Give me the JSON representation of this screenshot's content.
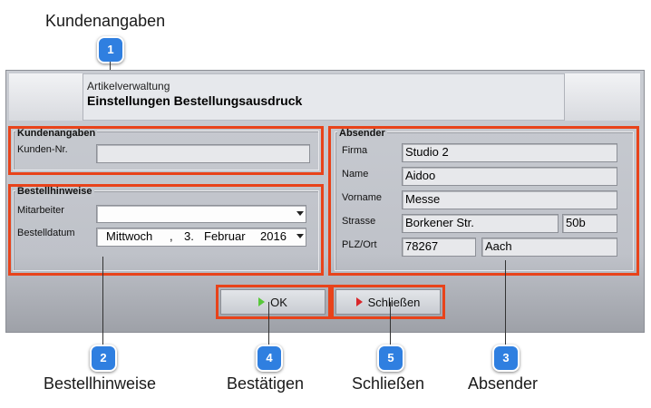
{
  "callouts": {
    "kundenangaben": {
      "text": "Kundenangaben",
      "num": "1"
    },
    "bestellhinweise": {
      "text": "Bestellhinweise",
      "num": "2"
    },
    "absender": {
      "text": "Absender",
      "num": "3"
    },
    "bestaetigen": {
      "text": "Bestätigen",
      "num": "4"
    },
    "schliessen": {
      "text": "Schließen",
      "num": "5"
    }
  },
  "header": {
    "subtitle": "Artikelverwaltung",
    "title": "Einstellungen Bestellungsausdruck"
  },
  "kunden": {
    "group_title": "Kundenangaben",
    "kunden_nr_label": "Kunden-Nr.",
    "kunden_nr_value": ""
  },
  "bestell": {
    "group_title": "Bestellhinweise",
    "mitarbeiter_label": "Mitarbeiter",
    "mitarbeiter_value": "",
    "bestelldatum_label": "Bestelldatum",
    "date_weekday": "Mittwoch",
    "date_sep": ",",
    "date_day": "3.",
    "date_month": "Februar",
    "date_year": "2016"
  },
  "absender": {
    "group_title": "Absender",
    "firma_label": "Firma",
    "firma_value": "Studio 2",
    "name_label": "Name",
    "name_value": "Aidoo",
    "vorname_label": "Vorname",
    "vorname_value": "Messe",
    "strasse_label": "Strasse",
    "strasse_value": "Borkener Str.",
    "hausnr_value": "50b",
    "plzort_label": "PLZ/Ort",
    "plz_value": "78267",
    "ort_value": "Aach"
  },
  "buttons": {
    "ok_label": "OK",
    "close_label": "Schließen"
  },
  "colors": {
    "highlight": "#e8431a",
    "badge": "#2f7fe0",
    "ok_icon": "#58c83a",
    "close_icon": "#d9262a"
  }
}
